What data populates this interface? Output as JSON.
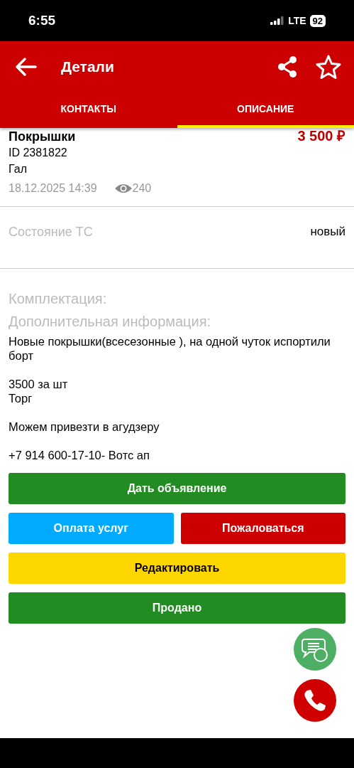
{
  "status_bar": {
    "time": "6:55",
    "network": "LTE",
    "battery": "92"
  },
  "header": {
    "title": "Детали"
  },
  "tabs": [
    {
      "label": "КОНТАКТЫ",
      "selected": false
    },
    {
      "label": "ОПИСАНИЕ",
      "selected": true
    }
  ],
  "listing": {
    "title": "Покрышки",
    "price": "3 500 ₽",
    "id": "ID 2381822",
    "location": "Гал",
    "date": "18.12.2025 14:39",
    "views": "240"
  },
  "specs": [
    {
      "label": "Состояние ТС",
      "value": "новый"
    }
  ],
  "sections": [
    {
      "label": "Комплектация:"
    },
    {
      "label": "Дополнительная информация:"
    }
  ],
  "description": [
    "Новые покрышки(всесезонные ), на одной чуток испортили борт",
    "3500 за шт\nТорг",
    "Можем привезти в агудзеру",
    "+7 914 600-17-10- Вотс ап"
  ],
  "button_rows": [
    [
      {
        "label": "Дать объявление",
        "color": "#228b22"
      }
    ],
    [
      {
        "label": "Оплата услуг",
        "color": "#00aaff"
      },
      {
        "label": "Пожаловаться",
        "color": "#cc0000"
      }
    ],
    [
      {
        "label": "Редактировать",
        "color": "#ffd700"
      }
    ],
    [
      {
        "label": "Продано",
        "color": "#228b22"
      }
    ]
  ]
}
